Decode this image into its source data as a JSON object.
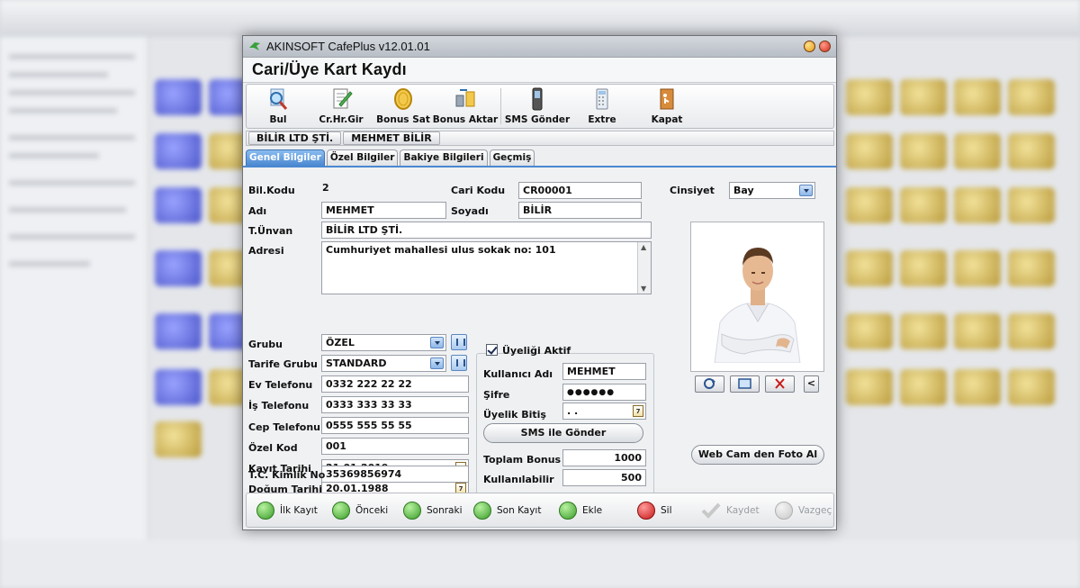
{
  "window": {
    "title": "AKINSOFT CafePlus v12.01.01",
    "header": "Cari/Üye Kart Kaydı"
  },
  "toolbar": [
    {
      "label": "Bul",
      "icon": "search-icon"
    },
    {
      "label": "Cr.Hr.Gir",
      "icon": "notepad-icon"
    },
    {
      "label": "Bonus Sat",
      "icon": "coin-icon"
    },
    {
      "label": "Bonus Aktar",
      "icon": "transfer-icon"
    },
    {
      "label": "SMS Gönder",
      "icon": "phone-icon"
    },
    {
      "label": "Extre",
      "icon": "calculator-icon"
    },
    {
      "label": "Kapat",
      "icon": "exit-door-icon"
    }
  ],
  "namebar": {
    "company": "BİLİR LTD ŞTİ.",
    "person": "MEHMET BİLİR"
  },
  "tabs": [
    "Genel Bilgiler",
    "Özel Bilgiler",
    "Bakiye Bilgileri",
    "Geçmiş"
  ],
  "form": {
    "bil_kodu": {
      "label": "Bil.Kodu",
      "value": "2"
    },
    "cari_kodu": {
      "label": "Cari Kodu",
      "value": "CR00001"
    },
    "cinsiyet": {
      "label": "Cinsiyet",
      "value": "Bay"
    },
    "adi": {
      "label": "Adı",
      "value": "MEHMET"
    },
    "soyadi": {
      "label": "Soyadı",
      "value": "BİLİR"
    },
    "unvan": {
      "label": "T.Ünvan",
      "value": "BİLİR LTD ŞTİ."
    },
    "adres": {
      "label": "Adresi",
      "value": "Cumhuriyet mahallesi ulus sokak no: 101"
    },
    "grubu": {
      "label": "Grubu",
      "value": "ÖZEL"
    },
    "tarife": {
      "label": "Tarife Grubu",
      "value": "STANDARD"
    },
    "ev_tel": {
      "label": "Ev Telefonu",
      "value": "0332 222 22 22"
    },
    "is_tel": {
      "label": "İş Telefonu",
      "value": "0333 333 33 33"
    },
    "cep_tel": {
      "label": "Cep Telefonu",
      "value": "0555 555 55 55"
    },
    "ozel_kod": {
      "label": "Özel Kod",
      "value": "001"
    },
    "kayit": {
      "label": "Kayıt Tarihi",
      "value": "21.01.2019"
    },
    "dogum": {
      "label": "Doğum Tarihi",
      "value": "20.01.1988"
    },
    "tc": {
      "label": "T.C. Kimlik No",
      "value": "35369856974"
    },
    "uyelik_aktif": {
      "label": "Üyeliği Aktif",
      "checked": true
    },
    "kullanici": {
      "label": "Kullanıcı Adı",
      "value": "MEHMET"
    },
    "sifre": {
      "label": "Şifre",
      "value": "●●●●●●"
    },
    "uyelik_bitis": {
      "label": "Üyelik Bitiş",
      "value": ". ."
    },
    "sms_button": "SMS ile Gönder",
    "toplam_bonus": {
      "label": "Toplam Bonus",
      "value": "1000"
    },
    "kullanilabilir": {
      "label": "Kullanılabilir",
      "value": "500"
    },
    "webcam_button": "Web Cam den Foto Al",
    "photo_prev": "<"
  },
  "nav": [
    {
      "label": "İlk Kayıt",
      "icon": "first-record-icon",
      "enabled": true
    },
    {
      "label": "Önceki",
      "icon": "previous-icon",
      "enabled": true
    },
    {
      "label": "Sonraki",
      "icon": "next-icon",
      "enabled": true
    },
    {
      "label": "Son Kayıt",
      "icon": "last-record-icon",
      "enabled": true
    },
    {
      "label": "Ekle",
      "icon": "add-icon",
      "enabled": true
    },
    {
      "label": "Sil",
      "icon": "delete-icon",
      "enabled": true
    },
    {
      "label": "Kaydet",
      "icon": "save-check-icon",
      "enabled": false
    },
    {
      "label": "Vazgeç",
      "icon": "cancel-icon",
      "enabled": false
    }
  ],
  "calendar_glyph": "7"
}
